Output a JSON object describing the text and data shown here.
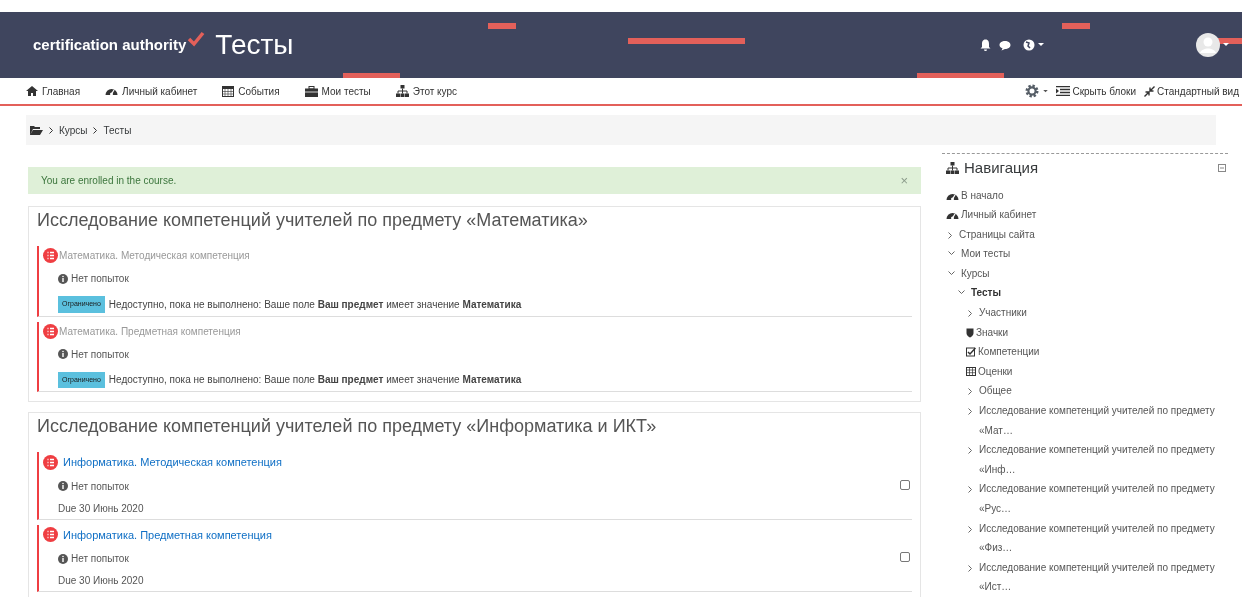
{
  "header": {
    "logo": "certification authority",
    "title": "Тесты"
  },
  "nav": [
    {
      "label": "Главная",
      "kind": "home"
    },
    {
      "label": "Личный кабинет",
      "kind": "dashboard"
    },
    {
      "label": "События",
      "kind": "calendar"
    },
    {
      "label": "Мои тесты",
      "kind": "briefcase"
    },
    {
      "label": "Этот курс",
      "kind": "sitemap"
    }
  ],
  "nav_right": [
    {
      "label": "Скрыть блоки",
      "kind": "hide"
    },
    {
      "label": "Стандартный вид",
      "kind": "compress"
    }
  ],
  "breadcrumb": [
    "Курсы",
    "Тесты"
  ],
  "alert": {
    "text": "You are enrolled in the course.",
    "close": "×"
  },
  "sections": [
    {
      "title": "Исследование компетенций учителей по предмету «Математика»",
      "activities": [
        {
          "kind": "restricted",
          "name": "Математика. Методическая компетенция",
          "attempts": "Нет попыток",
          "badge": "Ограничено",
          "restriction": "Недоступно, пока не выполнено: Ваше поле **Ваш предмет** имеет значение **Математика**"
        },
        {
          "kind": "restricted",
          "name": "Математика. Предметная компетенция",
          "attempts": "Нет попыток",
          "badge": "Ограничено",
          "restriction": "Недоступно, пока не выполнено: Ваше поле **Ваш предмет** имеет значение **Математика**"
        }
      ]
    },
    {
      "title": "Исследование компетенций учителей по предмету «Информатика и ИКТ»",
      "activities": [
        {
          "kind": "available",
          "name": "Информатика. Методическая компетенция",
          "attempts": "Нет попыток",
          "due": "Due 30 Июнь 2020",
          "checked": false
        },
        {
          "kind": "available",
          "name": "Информатика. Предметная компетенция",
          "attempts": "Нет попыток",
          "due": "Due 30 Июнь 2020",
          "checked": false
        }
      ]
    }
  ],
  "navigation": {
    "title": "Навигация",
    "items": [
      {
        "kind": "dashboard",
        "label": "В начало"
      },
      {
        "kind": "dashboard",
        "label": "Личный кабинет"
      },
      {
        "kind": "branch",
        "label": "Страницы сайта",
        "expanded": false
      },
      {
        "kind": "branch",
        "label": "Мои тесты",
        "expanded": true
      },
      {
        "kind": "branch",
        "label": "Курсы",
        "expanded": true,
        "children": [
          {
            "kind": "branch",
            "label": "Тесты",
            "expanded": true,
            "current": true,
            "children": [
              {
                "kind": "branch",
                "label": "Участники",
                "expanded": false
              },
              {
                "kind": "badges",
                "label": "Значки"
              },
              {
                "kind": "competencies",
                "label": "Компетенции"
              },
              {
                "kind": "grades",
                "label": "Оценки"
              },
              {
                "kind": "branch",
                "label": "Общее",
                "expanded": false
              },
              {
                "kind": "branch",
                "label": "Исследование компетенций учителей по предмету «Мат…",
                "expanded": false
              },
              {
                "kind": "branch",
                "label": "Исследование компетенций учителей по предмету «Инф…",
                "expanded": false
              },
              {
                "kind": "branch",
                "label": "Исследование компетенций учителей по предмету «Рус…",
                "expanded": false
              },
              {
                "kind": "branch",
                "label": "Исследование компетенций учителей по предмету «Физ…",
                "expanded": false
              },
              {
                "kind": "branch",
                "label": "Исследование компетенций учителей по предмету «Ист…",
                "expanded": false
              }
            ]
          }
        ]
      }
    ]
  }
}
